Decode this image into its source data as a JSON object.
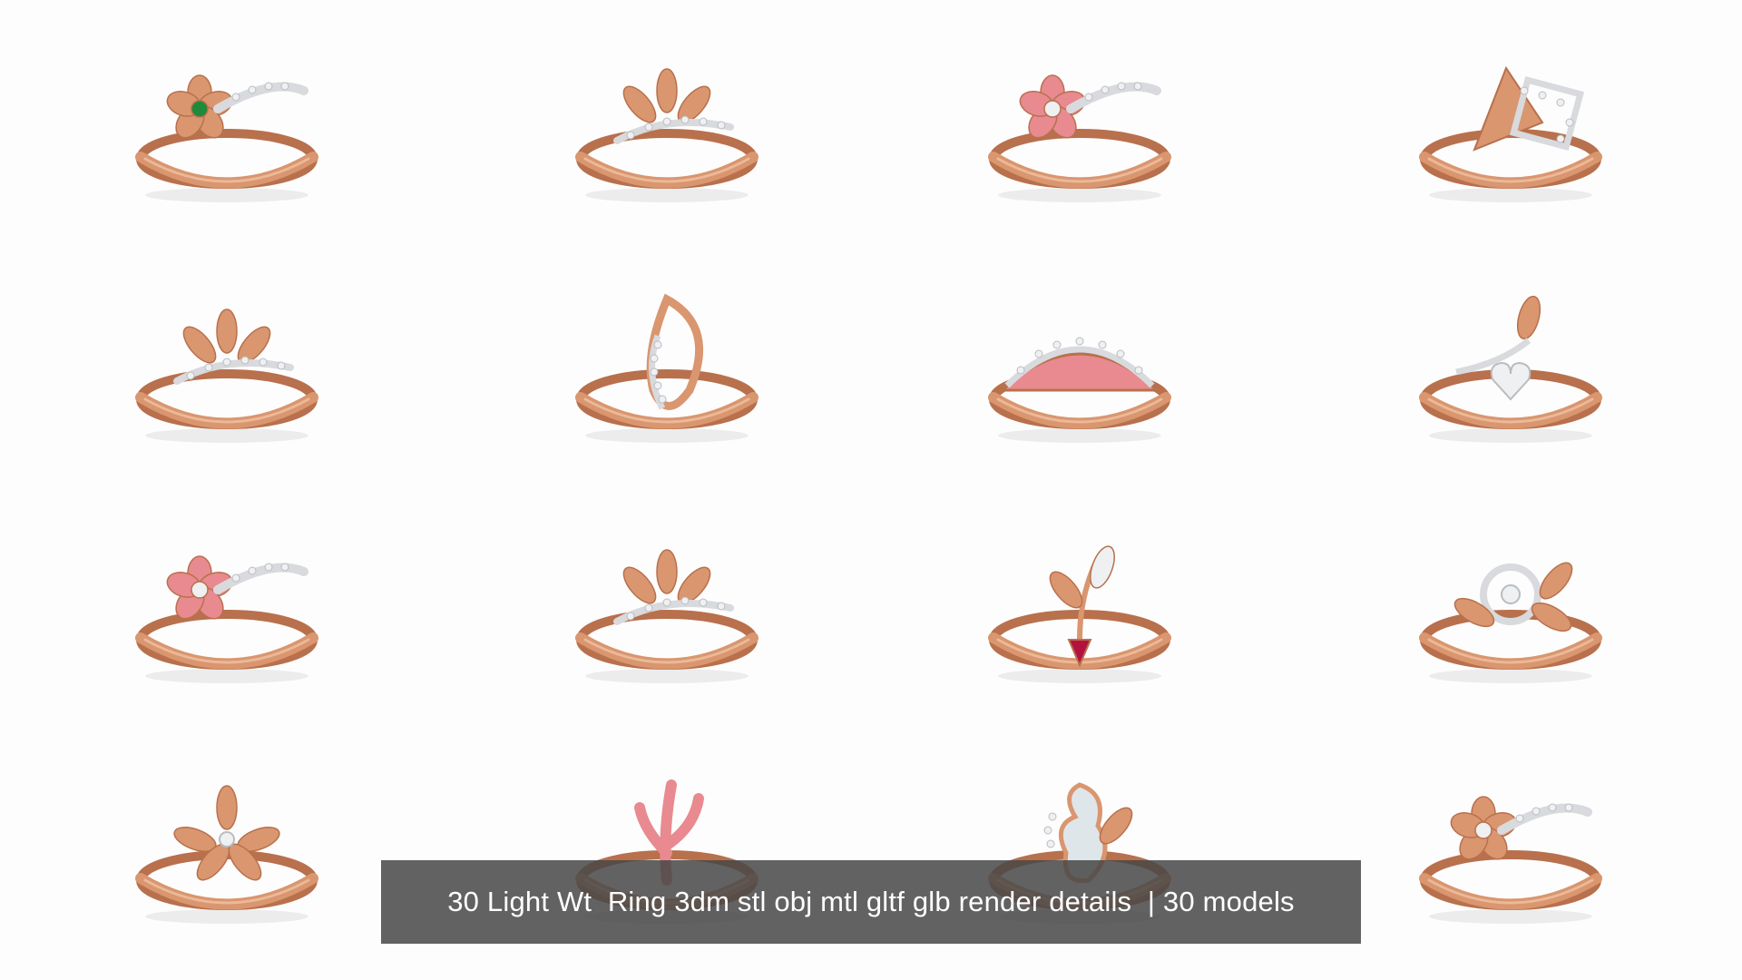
{
  "caption": {
    "text": "30 Light Wt  Ring 3dm stl obj mtl gltf glb render details  | 30 models"
  },
  "colors": {
    "background": "#fdfdfd",
    "rose_gold": "#d9966f",
    "rose_gold_dark": "#b8704d",
    "rose_gold_light": "#f0c2a2",
    "diamond": "#eef0f2",
    "emerald": "#1f8a3a",
    "pink_enamel": "#e88a8f",
    "ruby": "#b3123f",
    "caption_bg": "#464646",
    "caption_text": "#ffffff"
  },
  "rings": [
    {
      "name": "flower-emerald-ring",
      "motif": "flower",
      "accent": "emerald"
    },
    {
      "name": "paisley-leaf-ring",
      "motif": "leaves",
      "accent": "diamond"
    },
    {
      "name": "pink-flower-bypass-ring",
      "motif": "flower",
      "accent": "pink_enamel"
    },
    {
      "name": "geometric-square-ring",
      "motif": "square",
      "accent": "diamond"
    },
    {
      "name": "leaf-spray-ring",
      "motif": "leaves",
      "accent": "diamond"
    },
    {
      "name": "paisley-openwork-ring",
      "motif": "paisley",
      "accent": "diamond"
    },
    {
      "name": "enamel-dome-ring",
      "motif": "dome",
      "accent": "pink_enamel"
    },
    {
      "name": "leaf-heart-ring",
      "motif": "heart",
      "accent": "diamond"
    },
    {
      "name": "pink-blossom-ring",
      "motif": "flower",
      "accent": "pink_enamel"
    },
    {
      "name": "diamond-leaf-wrap-ring",
      "motif": "leaves",
      "accent": "diamond"
    },
    {
      "name": "ruby-sprig-ring",
      "motif": "sprig",
      "accent": "ruby"
    },
    {
      "name": "swirl-vine-ring",
      "motif": "swirl",
      "accent": "diamond"
    },
    {
      "name": "petal-star-ring",
      "motif": "petals",
      "accent": "diamond"
    },
    {
      "name": "coral-branch-ring",
      "motif": "coral",
      "accent": "pink_enamel"
    },
    {
      "name": "mother-of-pearl-ring",
      "motif": "pearl",
      "accent": "diamond"
    },
    {
      "name": "flower-cluster-ring",
      "motif": "flower",
      "accent": "diamond"
    }
  ]
}
